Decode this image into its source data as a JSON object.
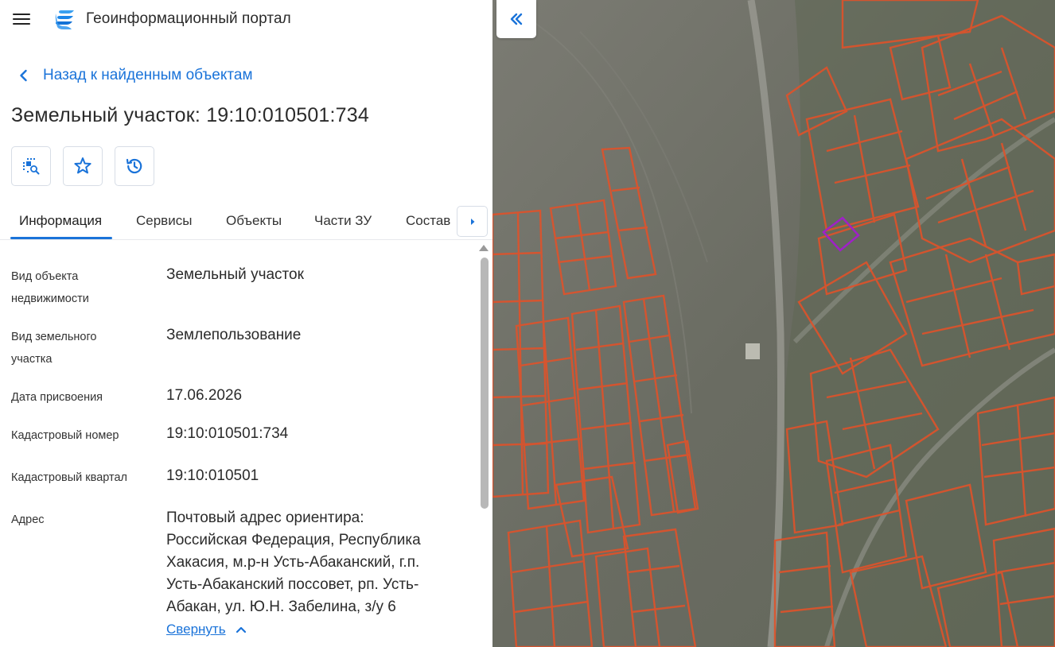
{
  "header": {
    "app_title": "Геоинформационный портал",
    "menu_icon": "hamburger-menu-icon",
    "logo_icon": "portal-logo-icon"
  },
  "navigation": {
    "back_label": "Назад к найденным объектам"
  },
  "object": {
    "title": "Земельный участок: 19:10:010501:734"
  },
  "toolbar": {
    "buttons": [
      {
        "icon": "locate-on-map-icon"
      },
      {
        "icon": "star-icon"
      },
      {
        "icon": "history-icon"
      }
    ]
  },
  "tabs": [
    {
      "label": "Информация",
      "active": true
    },
    {
      "label": "Сервисы",
      "active": false
    },
    {
      "label": "Объекты",
      "active": false
    },
    {
      "label": "Части ЗУ",
      "active": false
    },
    {
      "label": "Состав",
      "active": false
    }
  ],
  "info": {
    "rows": [
      {
        "label_line1": "Вид объекта",
        "label_line2": "недвижимости",
        "value": "Земельный участок"
      },
      {
        "label_line1": "Вид земельного",
        "label_line2": "участка",
        "value": "Землепользование"
      },
      {
        "label_line1": "Дата присвоения",
        "label_line2": "",
        "value": "17.06.2026"
      },
      {
        "label_line1": "Кадастровый номер",
        "label_line2": "",
        "value": "19:10:010501:734"
      },
      {
        "label_line1": "Кадастровый квартал",
        "label_line2": "",
        "value": "19:10:010501"
      }
    ],
    "address": {
      "label": "Адрес",
      "lines": [
        "Почтовый адрес ориентира:",
        "Российская Федерация, Республика",
        "Хакасия, м.р-н Усть-Абаканский, г.п.",
        "Усть-Абаканский поссовет, рп. Усть-",
        "Абакан, ул. Ю.Н. Забелина, з/у 6"
      ]
    },
    "collapse_label": "Свернуть"
  },
  "colors": {
    "accent": "#1a73d9",
    "parcel_outline": "#e0522a",
    "selected_parcel": "#a020c8"
  }
}
